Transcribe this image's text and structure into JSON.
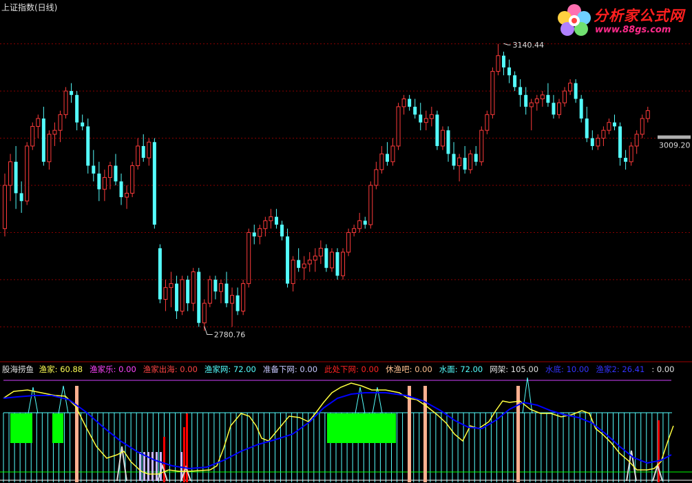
{
  "header": {
    "title": "上证指数(日线)"
  },
  "logo": {
    "text": "分析家公式网",
    "url": "www.88gs.com"
  },
  "price_labels": {
    "high": "3140.44",
    "low": "2780.76",
    "current": "3009.20"
  },
  "indicator": {
    "name": "股海捞鱼",
    "items": [
      {
        "label": "渔家",
        "value": "60.88",
        "color": "#ffff55"
      },
      {
        "label": "渔家乐",
        "value": "0.00",
        "color": "#ff44ff"
      },
      {
        "label": "渔家出海",
        "value": "0.00",
        "color": "#ff4444"
      },
      {
        "label": "渔家网",
        "value": "72.00",
        "color": "#55ffff"
      },
      {
        "label": "准备下网",
        "value": "0.00",
        "color": "#c8c8ff"
      },
      {
        "label": "此处下网",
        "value": "0.00",
        "color": "#ff2222"
      },
      {
        "label": "休渔吧",
        "value": "0.00",
        "color": "#ffc090"
      },
      {
        "label": "水面",
        "value": "72.00",
        "color": "#55ffff"
      },
      {
        "label": "网架",
        "value": "105.00",
        "color": "#e0e0e0"
      },
      {
        "label": "水底",
        "value": "10.00",
        "color": "#3333ff"
      },
      {
        "label": "渔家2",
        "value": "26.41",
        "color": "#3333ff"
      },
      {
        "label": "",
        "value": "0.00",
        "color": "#e0e0e0"
      }
    ]
  },
  "colors": {
    "up": "#ff3b3b",
    "down": "#54fcfc",
    "grid": "#8b0000",
    "fish_line": "#ffff40",
    "fish2_line": "#0000ff",
    "net_bar": "#55ffff",
    "rest_bar": "#ffb090",
    "block": "#00ff00"
  },
  "chart_data": {
    "type": "candlestick",
    "title": "上证指数(日线)",
    "price_range": [
      2740,
      3180
    ],
    "candles": [
      [
        2905,
        2975,
        2895,
        2960
      ],
      [
        2960,
        3000,
        2940,
        2990
      ],
      [
        2990,
        3010,
        2930,
        2950
      ],
      [
        2950,
        2965,
        2925,
        2940
      ],
      [
        2940,
        3015,
        2935,
        3010
      ],
      [
        3010,
        3040,
        3005,
        3035
      ],
      [
        3035,
        3050,
        3020,
        3045
      ],
      [
        3045,
        3060,
        2985,
        2990
      ],
      [
        2990,
        3030,
        2980,
        3025
      ],
      [
        3025,
        3040,
        3010,
        3030
      ],
      [
        3030,
        3055,
        3015,
        3050
      ],
      [
        3050,
        3085,
        3045,
        3080
      ],
      [
        3080,
        3090,
        3065,
        3075
      ],
      [
        3075,
        3080,
        3030,
        3040
      ],
      [
        3040,
        3050,
        3030,
        3035
      ],
      [
        3035,
        3045,
        2975,
        2985
      ],
      [
        2985,
        3005,
        2965,
        2975
      ],
      [
        2975,
        2990,
        2940,
        2955
      ],
      [
        2955,
        2980,
        2940,
        2970
      ],
      [
        2970,
        2990,
        2955,
        2985
      ],
      [
        2985,
        3000,
        2960,
        2965
      ],
      [
        2965,
        2975,
        2935,
        2945
      ],
      [
        2945,
        2960,
        2930,
        2950
      ],
      [
        2950,
        2990,
        2945,
        2985
      ],
      [
        2985,
        3020,
        2980,
        3010
      ],
      [
        3010,
        3025,
        2990,
        2995
      ],
      [
        2995,
        3020,
        2985,
        3015
      ],
      [
        3015,
        3020,
        2905,
        2910
      ],
      [
        2880,
        2885,
        2810,
        2815
      ],
      [
        2815,
        2840,
        2800,
        2830
      ],
      [
        2830,
        2850,
        2805,
        2835
      ],
      [
        2835,
        2845,
        2790,
        2800
      ],
      [
        2800,
        2845,
        2795,
        2840
      ],
      [
        2840,
        2845,
        2800,
        2810
      ],
      [
        2810,
        2855,
        2800,
        2850
      ],
      [
        2850,
        2855,
        2780,
        2785
      ],
      [
        2785,
        2815,
        2775,
        2810
      ],
      [
        2810,
        2845,
        2805,
        2840
      ],
      [
        2840,
        2845,
        2815,
        2825
      ],
      [
        2825,
        2840,
        2810,
        2835
      ],
      [
        2835,
        2850,
        2805,
        2810
      ],
      [
        2810,
        2830,
        2780,
        2820
      ],
      [
        2820,
        2830,
        2795,
        2800
      ],
      [
        2800,
        2840,
        2795,
        2835
      ],
      [
        2835,
        2905,
        2830,
        2900
      ],
      [
        2900,
        2910,
        2885,
        2895
      ],
      [
        2895,
        2910,
        2885,
        2905
      ],
      [
        2905,
        2920,
        2895,
        2915
      ],
      [
        2915,
        2930,
        2905,
        2920
      ],
      [
        2920,
        2930,
        2905,
        2910
      ],
      [
        2910,
        2915,
        2890,
        2895
      ],
      [
        2895,
        2905,
        2830,
        2835
      ],
      [
        2835,
        2870,
        2825,
        2865
      ],
      [
        2865,
        2880,
        2850,
        2855
      ],
      [
        2855,
        2870,
        2840,
        2860
      ],
      [
        2860,
        2875,
        2850,
        2865
      ],
      [
        2865,
        2880,
        2850,
        2870
      ],
      [
        2870,
        2890,
        2860,
        2880
      ],
      [
        2880,
        2885,
        2850,
        2855
      ],
      [
        2855,
        2880,
        2850,
        2875
      ],
      [
        2875,
        2880,
        2840,
        2845
      ],
      [
        2845,
        2880,
        2840,
        2875
      ],
      [
        2875,
        2905,
        2870,
        2900
      ],
      [
        2900,
        2910,
        2895,
        2905
      ],
      [
        2905,
        2925,
        2900,
        2915
      ],
      [
        2915,
        2920,
        2905,
        2910
      ],
      [
        2910,
        2965,
        2905,
        2960
      ],
      [
        2960,
        2990,
        2955,
        2980
      ],
      [
        2980,
        3010,
        2975,
        3000
      ],
      [
        3000,
        3015,
        2985,
        2990
      ],
      [
        2990,
        3020,
        2985,
        3010
      ],
      [
        3010,
        3065,
        3005,
        3060
      ],
      [
        3060,
        3075,
        3050,
        3070
      ],
      [
        3070,
        3075,
        3055,
        3060
      ],
      [
        3060,
        3070,
        3045,
        3050
      ],
      [
        3050,
        3065,
        3030,
        3040
      ],
      [
        3040,
        3055,
        3030,
        3045
      ],
      [
        3045,
        3060,
        3035,
        3050
      ],
      [
        3050,
        3055,
        3005,
        3010
      ],
      [
        3010,
        3035,
        3005,
        3030
      ],
      [
        3030,
        3035,
        2990,
        3000
      ],
      [
        3000,
        3015,
        2980,
        2985
      ],
      [
        2985,
        3000,
        2965,
        2995
      ],
      [
        2995,
        3010,
        2975,
        2980
      ],
      [
        2980,
        3005,
        2975,
        3000
      ],
      [
        3000,
        3010,
        2985,
        2990
      ],
      [
        2990,
        3035,
        2985,
        3030
      ],
      [
        3030,
        3055,
        3025,
        3050
      ],
      [
        3050,
        3110,
        3045,
        3105
      ],
      [
        3105,
        3140,
        3100,
        3125
      ],
      [
        3125,
        3130,
        3100,
        3110
      ],
      [
        3110,
        3120,
        3090,
        3100
      ],
      [
        3100,
        3105,
        3080,
        3085
      ],
      [
        3085,
        3095,
        3060,
        3075
      ],
      [
        3075,
        3085,
        3050,
        3060
      ],
      [
        3060,
        3070,
        3030,
        3065
      ],
      [
        3065,
        3075,
        3055,
        3070
      ],
      [
        3070,
        3080,
        3060,
        3075
      ],
      [
        3075,
        3090,
        3060,
        3065
      ],
      [
        3065,
        3075,
        3045,
        3050
      ],
      [
        3050,
        3070,
        3045,
        3065
      ],
      [
        3065,
        3085,
        3060,
        3080
      ],
      [
        3080,
        3095,
        3075,
        3090
      ],
      [
        3090,
        3095,
        3065,
        3070
      ],
      [
        3070,
        3075,
        3040,
        3045
      ],
      [
        3045,
        3060,
        3015,
        3020
      ],
      [
        3020,
        3030,
        3005,
        3010
      ],
      [
        3010,
        3025,
        3005,
        3020
      ],
      [
        3020,
        3035,
        3010,
        3030
      ],
      [
        3030,
        3045,
        3025,
        3040
      ],
      [
        3040,
        3050,
        3030,
        3035
      ],
      [
        3035,
        3040,
        2985,
        2995
      ],
      [
        2995,
        3005,
        2980,
        2990
      ],
      [
        2990,
        3015,
        2985,
        3010
      ],
      [
        3010,
        3030,
        3000,
        3025
      ],
      [
        3025,
        3050,
        3020,
        3045
      ],
      [
        3045,
        3060,
        3040,
        3055
      ]
    ],
    "labels": [
      {
        "text": "3140.44",
        "index": 90,
        "price": 3140.44
      },
      {
        "text": "2780.76",
        "index": 36,
        "price": 2780.76
      },
      {
        "text": "3009.20",
        "index": 117,
        "price": 3009.2
      }
    ]
  }
}
